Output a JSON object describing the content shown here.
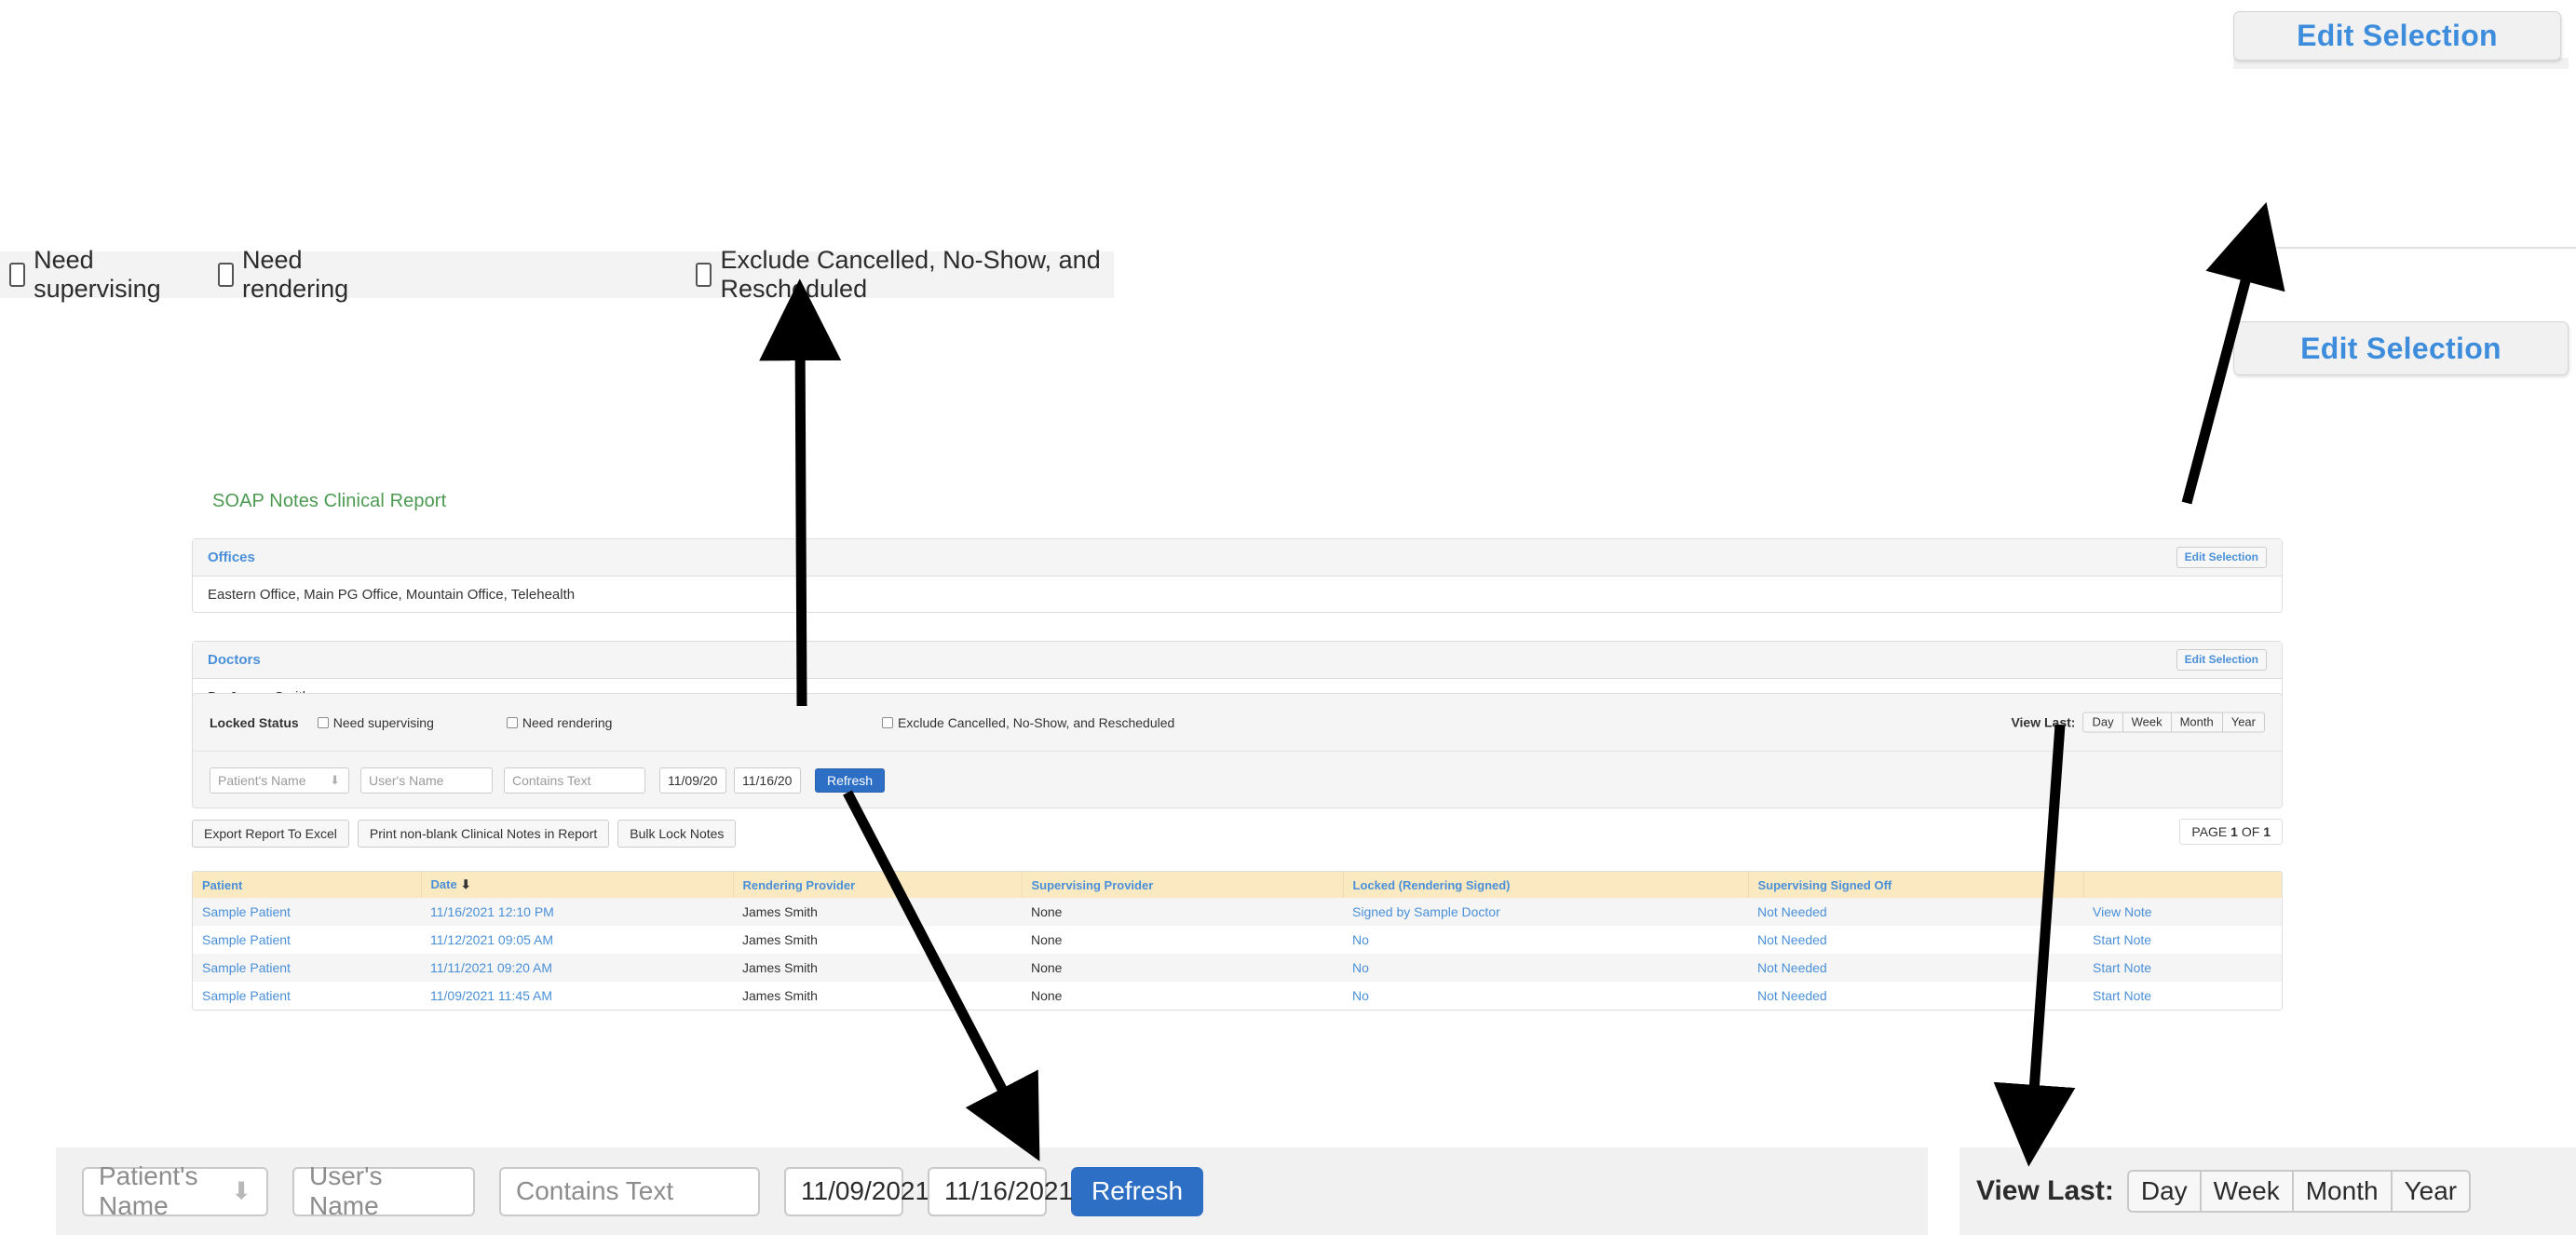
{
  "report": {
    "title": "SOAP Notes Clinical Report"
  },
  "offices": {
    "title": "Offices",
    "edit_label": "Edit Selection",
    "value": "Eastern Office, Main PG Office, Mountain Office, Telehealth"
  },
  "doctors": {
    "title": "Doctors",
    "edit_label": "Edit Selection",
    "value": "Dr. James Smith"
  },
  "filters": {
    "locked_status_label": "Locked Status",
    "need_supervising_label": "Need supervising",
    "need_rendering_label": "Need rendering",
    "exclude_label": "Exclude Cancelled, No-Show, and Rescheduled",
    "view_last_label": "View Last:",
    "view_last_options": [
      "Day",
      "Week",
      "Month",
      "Year"
    ],
    "patient_name_placeholder": "Patient's Name",
    "user_name_placeholder": "User's Name",
    "contains_text_placeholder": "Contains Text",
    "date_from": "11/09/2021",
    "date_to": "11/16/2021",
    "refresh_label": "Refresh"
  },
  "actions": {
    "export_label": "Export Report To Excel",
    "print_label": "Print non-blank Clinical Notes in Report",
    "bulk_lock_label": "Bulk Lock Notes",
    "page_prefix": "PAGE",
    "page_current": "1",
    "page_of": "OF",
    "page_total": "1"
  },
  "table": {
    "columns": [
      "Patient",
      "Date",
      "Rendering Provider",
      "Supervising Provider",
      "Locked (Rendering Signed)",
      "Supervising Signed Off",
      ""
    ],
    "sorted_column": "Date",
    "sort_direction": "descending",
    "rows": [
      {
        "patient": "Sample Patient",
        "date": "11/16/2021 12:10 PM",
        "rendering_provider": "James Smith",
        "supervising_provider": "None",
        "locked": "Signed by Sample Doctor",
        "supervising_signed_off": "Not Needed",
        "action": "View Note"
      },
      {
        "patient": "Sample Patient",
        "date": "11/12/2021 09:05 AM",
        "rendering_provider": "James Smith",
        "supervising_provider": "None",
        "locked": "No",
        "supervising_signed_off": "Not Needed",
        "action": "Start Note"
      },
      {
        "patient": "Sample Patient",
        "date": "11/11/2021 09:20 AM",
        "rendering_provider": "James Smith",
        "supervising_provider": "None",
        "locked": "No",
        "supervising_signed_off": "Not Needed",
        "action": "Start Note"
      },
      {
        "patient": "Sample Patient",
        "date": "11/09/2021 11:45 AM",
        "rendering_provider": "James Smith",
        "supervising_provider": "None",
        "locked": "No",
        "supervising_signed_off": "Not Needed",
        "action": "Start Note"
      }
    ]
  },
  "callouts": {
    "checkbox_strip": {
      "need_supervising": "Need supervising",
      "need_rendering": "Need rendering",
      "exclude": "Exclude Cancelled, No-Show, and Rescheduled"
    },
    "edit_selection_top": "Edit Selection",
    "edit_selection_second": "Edit Selection",
    "form": {
      "patient_name_placeholder": "Patient's Name",
      "user_name_placeholder": "User's Name",
      "contains_text_placeholder": "Contains Text",
      "date_from": "11/09/2021",
      "date_to": "11/16/2021",
      "refresh_label": "Refresh"
    },
    "view_last": {
      "label": "View Last:",
      "options": [
        "Day",
        "Week",
        "Month",
        "Year"
      ]
    }
  },
  "colors": {
    "title_green": "#4c9a52",
    "link_blue": "#4a90d9",
    "table_header_bg": "#fbe9c2",
    "primary_button": "#2d6fc4"
  }
}
